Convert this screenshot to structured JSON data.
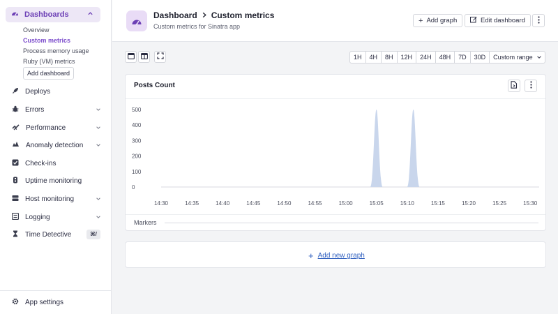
{
  "sidebar": {
    "dashboards": {
      "label": "Dashboards",
      "items": [
        "Overview",
        "Custom metrics",
        "Process memory usage",
        "Ruby (VM) metrics"
      ],
      "active_item": "Custom metrics",
      "add_label": "Add dashboard"
    },
    "nav": [
      {
        "label": "Deploys",
        "icon": "rocket-icon",
        "chevron": false
      },
      {
        "label": "Errors",
        "icon": "bug-icon",
        "chevron": true
      },
      {
        "label": "Performance",
        "icon": "speedometer-icon",
        "chevron": true
      },
      {
        "label": "Anomaly detection",
        "icon": "alert-icon",
        "chevron": true
      },
      {
        "label": "Check-ins",
        "icon": "check-icon",
        "chevron": false
      },
      {
        "label": "Uptime monitoring",
        "icon": "uptime-icon",
        "chevron": false
      },
      {
        "label": "Host monitoring",
        "icon": "server-icon",
        "chevron": true
      },
      {
        "label": "Logging",
        "icon": "logs-icon",
        "chevron": true
      },
      {
        "label": "Time Detective",
        "icon": "hourglass-icon",
        "chevron": false
      }
    ],
    "shortcut": "⌘/",
    "settings_label": "App settings"
  },
  "header": {
    "crumb_parent": "Dashboard",
    "crumb_current": "Custom metrics",
    "subtitle": "Custom metrics for Sinatra app",
    "add_graph": "Add graph",
    "edit_dashboard": "Edit dashboard"
  },
  "toolbar": {
    "ranges": [
      "1H",
      "4H",
      "8H",
      "12H",
      "24H",
      "48H",
      "7D",
      "30D"
    ],
    "custom_range": "Custom range"
  },
  "graph": {
    "title": "Posts Count",
    "markers_label": "Markers"
  },
  "add_new_graph": "Add new graph",
  "colors": {
    "accent": "#6c3fb5",
    "accent_bg": "#ede7f6",
    "series_fill": "#c9d6ec",
    "link": "#2f5fbf"
  },
  "chart_data": {
    "type": "area",
    "x": [
      "14:30",
      "14:31",
      "14:32",
      "14:33",
      "14:34",
      "14:35",
      "14:36",
      "14:37",
      "14:38",
      "14:39",
      "14:40",
      "14:41",
      "14:42",
      "14:43",
      "14:44",
      "14:45",
      "14:46",
      "14:47",
      "14:48",
      "14:49",
      "14:50",
      "14:51",
      "14:52",
      "14:53",
      "14:54",
      "14:55",
      "14:56",
      "14:57",
      "14:58",
      "14:59",
      "15:00",
      "15:01",
      "15:02",
      "15:03",
      "15:04",
      "15:05",
      "15:06",
      "15:07",
      "15:08",
      "15:09",
      "15:10",
      "15:11",
      "15:12",
      "15:13",
      "15:14",
      "15:15",
      "15:16",
      "15:17",
      "15:18",
      "15:19",
      "15:20",
      "15:21",
      "15:22",
      "15:23",
      "15:24",
      "15:25",
      "15:26",
      "15:27",
      "15:28",
      "15:29",
      "15:30",
      "15:31"
    ],
    "values": [
      0,
      0,
      0,
      0,
      0,
      0,
      0,
      0,
      0,
      0,
      0,
      0,
      0,
      0,
      0,
      0,
      0,
      0,
      0,
      0,
      0,
      0,
      0,
      0,
      0,
      0,
      0,
      0,
      0,
      0,
      0,
      0,
      0,
      0,
      0,
      500,
      0,
      0,
      0,
      0,
      0,
      500,
      0,
      0,
      0,
      0,
      0,
      0,
      0,
      0,
      0,
      0,
      0,
      0,
      0,
      0,
      0,
      0,
      0,
      0,
      0,
      0
    ],
    "x_tick_labels": [
      "14:30",
      "14:35",
      "14:40",
      "14:45",
      "14:50",
      "14:55",
      "15:00",
      "15:05",
      "15:10",
      "15:15",
      "15:20",
      "15:25",
      "15:30"
    ],
    "y_ticks": [
      0,
      100,
      200,
      300,
      400,
      500
    ],
    "ylim": [
      0,
      500
    ],
    "title": "Posts Count",
    "grid": false,
    "legend": "none"
  }
}
